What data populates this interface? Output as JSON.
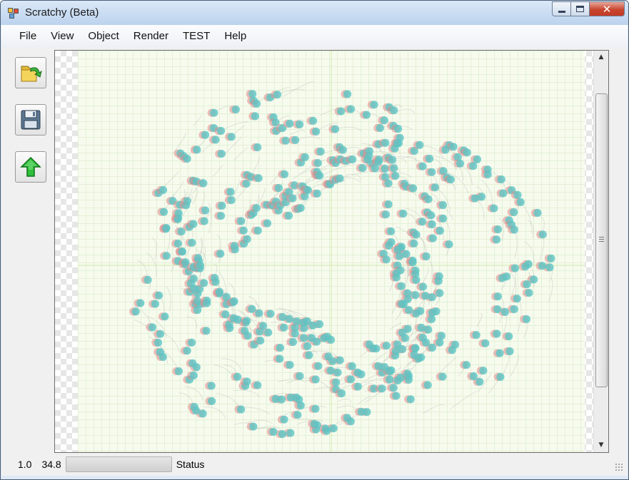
{
  "window": {
    "title": "Scratchy (Beta)",
    "close_glyph": "✕"
  },
  "menu": [
    "File",
    "View",
    "Object",
    "Render",
    "TEST",
    "Help"
  ],
  "toolbar": [
    {
      "name": "open-button",
      "icon": "folder-open-icon"
    },
    {
      "name": "save-button",
      "icon": "floppy-disk-icon"
    },
    {
      "name": "upload-button",
      "icon": "green-up-arrow-icon"
    }
  ],
  "canvas": {
    "dot_color": "#5bc6c4",
    "ghost_color": "#e08a8a",
    "axis_color": "#d3e8a8"
  },
  "scrollbar": {
    "up": "▲",
    "down": "▼"
  },
  "status": {
    "zoom": "1.0",
    "value": "34.8",
    "label": "Status",
    "progress": 0
  }
}
